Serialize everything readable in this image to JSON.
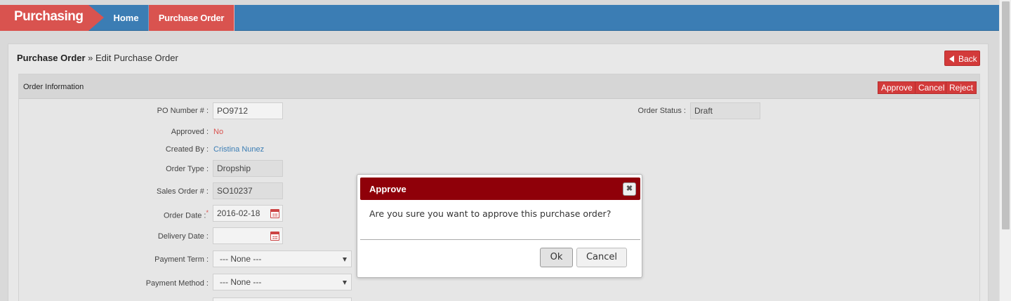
{
  "nav": {
    "brand": "Purchasing",
    "home": "Home",
    "current": "Purchase Order"
  },
  "breadcrumb": {
    "root": "Purchase Order",
    "separator": " » ",
    "current": "Edit Purchase Order"
  },
  "back_label": "Back",
  "section": {
    "title": "Order Information",
    "approve": "Approve",
    "cancel": "Cancel",
    "reject": "Reject"
  },
  "form": {
    "po_number_label": "PO Number # :",
    "po_number": "PO9712",
    "approved_label": "Approved :",
    "approved": "No",
    "created_by_label": "Created By :",
    "created_by": "Cristina Nunez",
    "order_type_label": "Order Type :",
    "order_type": "Dropship",
    "sales_order_label": "Sales Order # :",
    "sales_order": "SO10237",
    "order_date_label": "Order Date :",
    "required_mark": "*",
    "order_date": "2016-02-18",
    "delivery_date_label": "Delivery Date :",
    "delivery_date": "",
    "payment_term_label": "Payment Term :",
    "payment_term": "--- None ---",
    "payment_method_label": "Payment Method :",
    "payment_method": "--- None ---",
    "order_status_label": "Order Status :",
    "order_status": "Draft"
  },
  "modal": {
    "title": "Approve",
    "close": "✖",
    "message": "Are you sure you want to approve this purchase order?",
    "ok": "Ok",
    "cancel": "Cancel"
  },
  "colors": {
    "nav_blue": "#3b7db4",
    "accent_red": "#d9534f",
    "modal_header": "#8f0009",
    "approved_no": "#d9534f",
    "link_blue": "#3b7db4"
  }
}
